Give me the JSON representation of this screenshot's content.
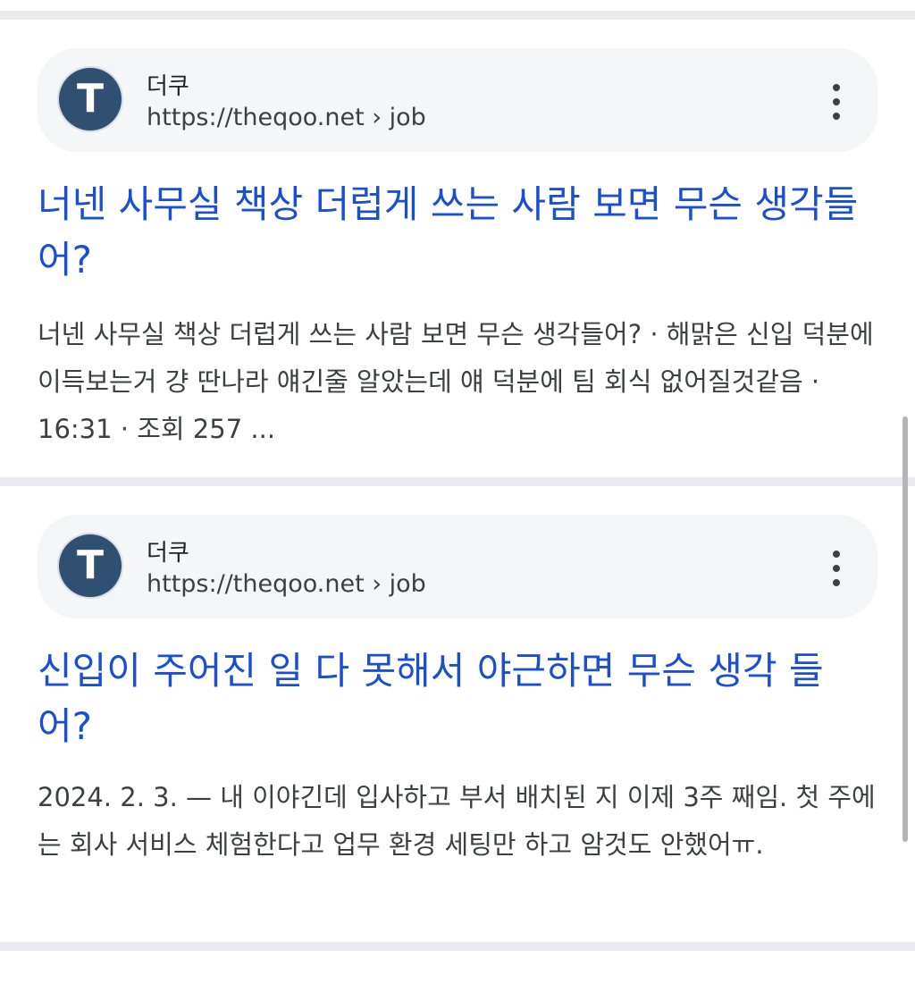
{
  "results": [
    {
      "favicon_letter": "T",
      "site_name": "더쿠",
      "url": "https://theqoo.net › job",
      "title": "너넨 사무실 책상 더럽게 쓰는 사람 보면 무슨 생각들어?",
      "snippet": "너넨 사무실 책상 더럽게 쓰는 사람 보면 무슨 생각들어? · 해맑은 신입 덕분에 이득보는거 걍 딴나라 얘긴줄 알았는데 얘 덕분에 팀 회식 없어질것같음 · 16:31 · 조회 257 ..."
    },
    {
      "favicon_letter": "T",
      "site_name": "더쿠",
      "url": "https://theqoo.net › job",
      "title": "신입이 주어진 일 다 못해서 야근하면 무슨 생각 들어?",
      "snippet": "2024. 2. 3. — 내 이야긴데 입사하고 부서 배치된 지 이제 3주 째임. 첫 주에는 회사 서비스 체험한다고 업무 환경 세팅만 하고 암것도 안했어ㅠ."
    }
  ],
  "icons": {
    "more": "more-vertical-icon"
  },
  "colors": {
    "title_link": "#1a4fd1",
    "snippet_text": "#3c4043",
    "divider": "#e9eaee",
    "favicon_bg": "#2f5070"
  }
}
